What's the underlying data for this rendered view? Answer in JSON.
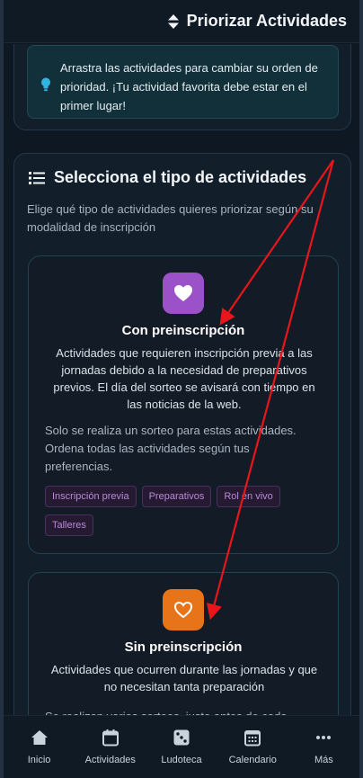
{
  "header": {
    "title": "Priorizar Actividades",
    "icon": "sort-icon"
  },
  "tip": {
    "text": "Arrastra las actividades para cambiar su orden de prioridad. ¡Tu actividad favorita debe estar en el primer lugar!",
    "icon": "lightbulb-icon"
  },
  "section": {
    "title": "Selecciona el tipo de actividades",
    "description": "Elige qué tipo de actividades quieres priorizar según su modalidad de inscripción",
    "icon": "list-icon"
  },
  "options": [
    {
      "title": "Con preinscripción",
      "description": "Actividades que requieren inscripción previa a las jornadas debido a la necesidad de preparativos previos. El día del sorteo se avisará con tiempo en las noticias de la web.",
      "extra": "Solo se realiza un sorteo para estas actividades. Ordena todas las actividades según tus preferencias.",
      "icon": "heart-icon",
      "color": "#9b51c8",
      "tags": [
        "Inscripción previa",
        "Preparativos",
        "Rol en vivo",
        "Talleres"
      ]
    },
    {
      "title": "Sin preinscripción",
      "description": "Actividades que ocurren durante las jornadas y que no necesitan tanta preparación",
      "extra": "Se realizan varios sorteos, justo antes de cada",
      "icon": "heart-outline-icon",
      "color": "#e8741a"
    }
  ],
  "nav": {
    "items": [
      {
        "label": "Inicio",
        "icon": "home-icon"
      },
      {
        "label": "Actividades",
        "icon": "calendar-icon"
      },
      {
        "label": "Ludoteca",
        "icon": "dice-icon"
      },
      {
        "label": "Calendario",
        "icon": "calendar-grid-icon"
      },
      {
        "label": "Más",
        "icon": "more-icon"
      }
    ]
  },
  "annotation_color": "#e8151b"
}
